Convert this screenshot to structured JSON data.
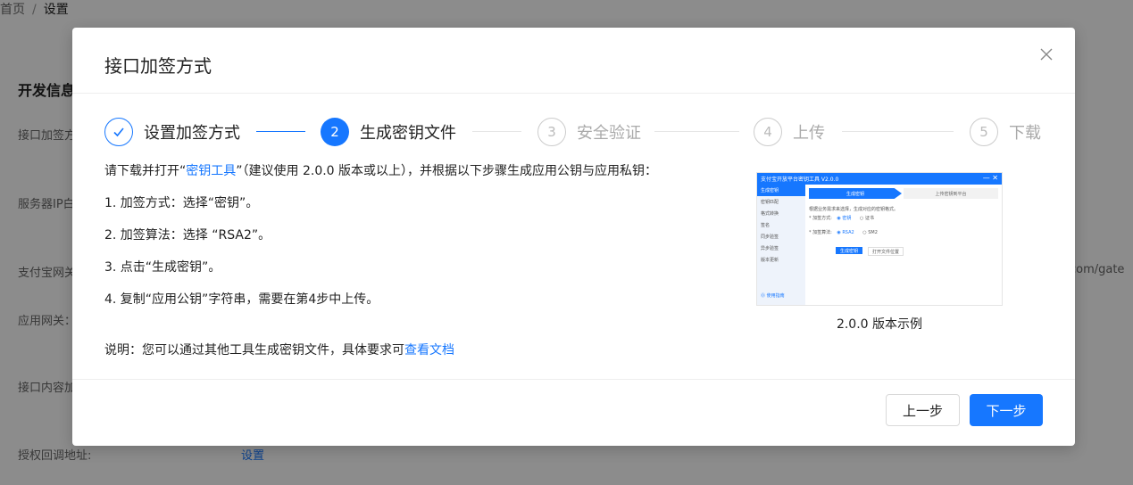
{
  "breadcrumb": {
    "home": "首页",
    "separator": "/",
    "current": "设置"
  },
  "background": {
    "section_title": "开发信息",
    "labels": [
      "接口加签方",
      "服务器IP白",
      "支付宝网关",
      "应用网关：",
      "接口内容加",
      "授权回调地址:"
    ],
    "gateway_fragment": "y.com/gate",
    "callback_link": "设置"
  },
  "modal": {
    "title": "接口加签方式",
    "close_icon": "close-icon",
    "steps": [
      {
        "number": "1",
        "label": "设置加签方式",
        "status": "done"
      },
      {
        "number": "2",
        "label": "生成密钥文件",
        "status": "active"
      },
      {
        "number": "3",
        "label": "安全验证",
        "status": "wait"
      },
      {
        "number": "4",
        "label": "上传",
        "status": "wait"
      },
      {
        "number": "5",
        "label": "下载",
        "status": "wait"
      }
    ],
    "intro": {
      "before": "请下载并打开“",
      "link": "密钥工具",
      "after": "”（建议使用 2.0.0 版本或以上），并根据以下步骤生成应用公钥与应用私钥："
    },
    "instructions": [
      "1. 加签方式：选择“密钥”。",
      "2. 加签算法：选择 “RSA2”。",
      "3. 点击“生成密钥”。",
      "4. 复制“应用公钥”字符串，需要在第4步中上传。"
    ],
    "note": {
      "before": "说明：您可以通过其他工具生成密钥文件，具体要求可",
      "link": "查看文档"
    },
    "preview": {
      "window_title": "支付宝开放平台密钥工具 V2.0.0",
      "window_controls": "— ✕",
      "sidebar": [
        "生成密钥",
        "密钥匹配",
        "格式转换",
        "签名",
        "同步验签",
        "异步验签",
        "版本更新"
      ],
      "sidebar_help": "⓪ 使用指南",
      "tab_active": "生成密钥",
      "tab_inactive": "上传密钥到平台",
      "hint": "根据业务需求来选择，生成对应的密钥格式。",
      "method_label": "* 加签方式:",
      "method_selected": "◉ 密钥",
      "method_other": "○ 证书",
      "algo_label": "* 加签算法:",
      "algo_selected": "◉ RSA2",
      "algo_other": "○ SM2",
      "generate_button": "生成密钥",
      "open_location_button": "打开文件位置",
      "caption": "2.0.0 版本示例"
    },
    "buttons": {
      "prev": "上一步",
      "next": "下一步"
    }
  },
  "colors": {
    "primary": "#1677ff",
    "overlay": "rgba(0,0,0,0.45)"
  }
}
